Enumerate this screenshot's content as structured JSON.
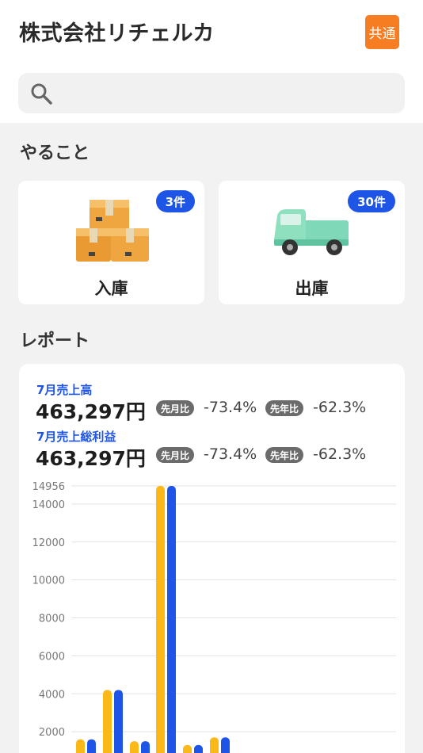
{
  "header": {
    "company_name": "株式会社リチェルカ",
    "common_badge": "共通"
  },
  "search": {
    "placeholder": ""
  },
  "todo": {
    "title": "やること",
    "cards": [
      {
        "label": "入庫",
        "count": "3件",
        "icon": "boxes-icon"
      },
      {
        "label": "出庫",
        "count": "30件",
        "icon": "truck-icon"
      }
    ]
  },
  "report": {
    "title": "レポート",
    "metrics": [
      {
        "label": "7月売上高",
        "value": "463,297円",
        "mom_label": "先月比",
        "mom": "-73.4%",
        "yoy_label": "先年比",
        "yoy": "-62.3%"
      },
      {
        "label": "7月売上総利益",
        "value": "463,297円",
        "mom_label": "先月比",
        "mom": "-73.4%",
        "yoy_label": "先年比",
        "yoy": "-62.3%"
      }
    ]
  },
  "colors": {
    "accent": "#1f55e6",
    "orange": "#f77d23",
    "bar_yellow": "#fbb819",
    "bar_blue": "#1f55e6"
  },
  "chart_data": {
    "type": "bar",
    "y_ticks": [
      "2000",
      "4000",
      "6000",
      "8000",
      "10000",
      "12000",
      "14000",
      "14956"
    ],
    "ylim": [
      0,
      14956
    ],
    "series": [
      {
        "values": [
          1600,
          4200,
          1500,
          14956,
          1300,
          1700
        ]
      },
      {
        "values": [
          1600,
          4200,
          1500,
          14956,
          1300,
          1700
        ]
      }
    ],
    "grid": true
  }
}
